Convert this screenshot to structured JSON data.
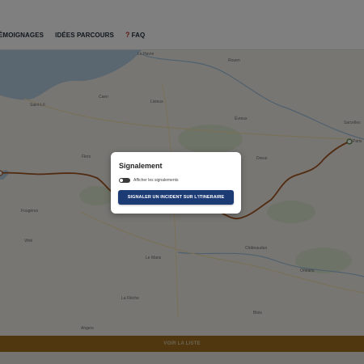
{
  "nav": {
    "items": [
      {
        "label": "ÉMOIGNAGES"
      },
      {
        "label": "IDÉES PARCOURS"
      },
      {
        "label": "FAQ",
        "icon": "question-mark-icon"
      }
    ]
  },
  "map": {
    "cities": [
      {
        "name": "Le Havre"
      },
      {
        "name": "Rouen"
      },
      {
        "name": "Caen"
      },
      {
        "name": "Lisieux"
      },
      {
        "name": "Saint-Lô"
      },
      {
        "name": "Évreux"
      },
      {
        "name": "Sarcelles"
      },
      {
        "name": "Paris"
      },
      {
        "name": "Flers"
      },
      {
        "name": "Dreux"
      },
      {
        "name": "Fougères"
      },
      {
        "name": "Vitré"
      },
      {
        "name": "Châteaudun"
      },
      {
        "name": "Le Mans"
      },
      {
        "name": "Orléans"
      },
      {
        "name": "La Flèche"
      },
      {
        "name": "Blois"
      },
      {
        "name": "Angers"
      }
    ],
    "route_color": "#a2541f",
    "water_color": "#b5cde0"
  },
  "modal": {
    "title": "Signalement",
    "toggle_label": "Afficher les signalements",
    "toggle_on": false,
    "button_label": "SIGNALER UN INCIDENT SUR L'ITINERAIRE"
  },
  "bottom_bar": {
    "label": "VOIR LA LISTE",
    "color": "#a16f1f"
  }
}
